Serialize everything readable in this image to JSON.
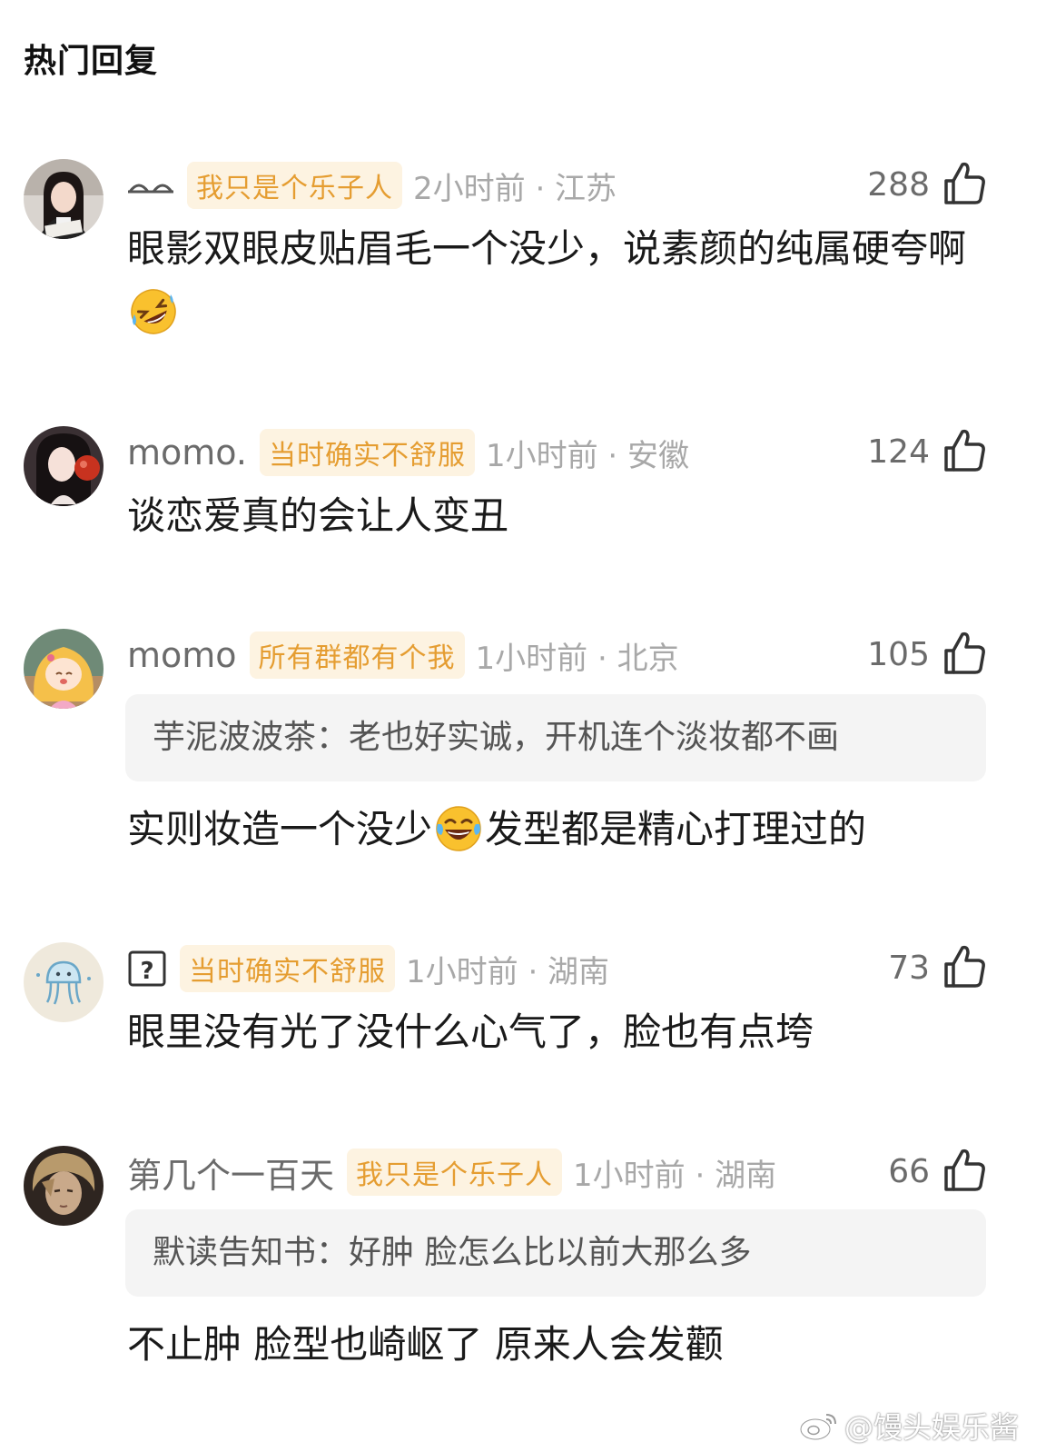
{
  "header": {
    "title": "热门回复"
  },
  "comments": [
    {
      "username": "",
      "username_icon": "closed-eyes-icon",
      "badge": "我只是个乐子人",
      "time": "2小时前 · 江苏",
      "likes": "288",
      "text_part1": "眼影双眼皮贴眉毛一个没少，说素颜的纯属硬夸啊",
      "emoji": "rofl-emoji"
    },
    {
      "username": "momo.",
      "badge": "当时确实不舒服",
      "time": "1小时前 · 安徽",
      "likes": "124",
      "text": "谈恋爱真的会让人变丑"
    },
    {
      "username": "momo",
      "badge": "所有群都有个我",
      "time": "1小时前 · 北京",
      "likes": "105",
      "quote": "芋泥波波茶：老也好实诚，开机连个淡妆都不画",
      "text_part1": "实则妆造一个没少",
      "emoji": "tears-of-joy-emoji",
      "text_part2": "发型都是精心打理过的"
    },
    {
      "username": "",
      "username_icon": "question-box-icon",
      "badge": "当时确实不舒服",
      "time": "1小时前 · 湖南",
      "likes": "73",
      "text": "眼里没有光了没什么心气了，脸也有点垮"
    },
    {
      "username": "第几个一百天",
      "badge": "我只是个乐子人",
      "time": "1小时前 · 湖南",
      "likes": "66",
      "quote": "默读告知书：好肿 脸怎么比以前大那么多",
      "text": "不止肿 脸型也崎岖了 原来人会发颧"
    }
  ],
  "watermark": "@馒头娱乐酱",
  "colors": {
    "badge_bg": "#fdf3e1",
    "badge_text": "#e59d31",
    "quote_bg": "#f4f4f4",
    "meta_gray": "#a8a8a8"
  }
}
